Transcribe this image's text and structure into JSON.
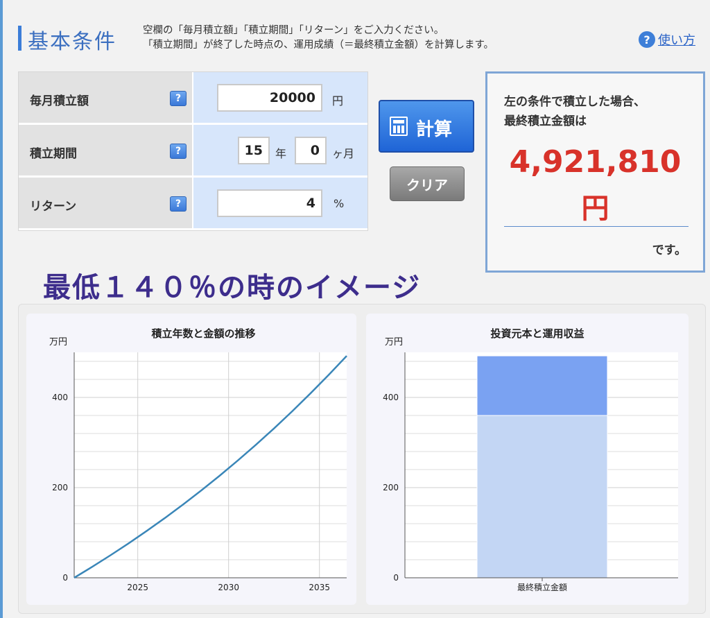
{
  "header": {
    "title": "基本条件",
    "desc_line1": "空欄の「毎月積立額」「積立期間」「リターン」をご入力ください。",
    "desc_line2": "「積立期間」が終了した時点の、運用成績（＝最終積立金額）を計算します。",
    "help_icon": "?",
    "help_label": "使い方"
  },
  "form": {
    "help_icon": "?",
    "monthly": {
      "label": "毎月積立額",
      "value": "20000",
      "unit": "円"
    },
    "period": {
      "label": "積立期間",
      "years": "15",
      "years_unit": "年",
      "months": "0",
      "months_unit": "ヶ月"
    },
    "return": {
      "label": "リターン",
      "value": "4",
      "unit": "%"
    }
  },
  "buttons": {
    "calc": "計算",
    "clear": "クリア"
  },
  "result": {
    "line1": "左の条件で積立した場合、",
    "line2": "最終積立金額は",
    "amount": "4,921,810",
    "unit": "円",
    "suffix": "です。"
  },
  "image_heading": "最低１４０％の時のイメージ",
  "colors": {
    "accent": "#3b7dd8",
    "result_red": "#d8322a",
    "line": "#3a86b8",
    "principal": "#c3d6f4",
    "profit": "#7aa2f2"
  },
  "chart_data": [
    {
      "type": "line",
      "title": "積立年数と金額の推移",
      "ylabel": "万円",
      "xlim": [
        2021.5,
        2036.5
      ],
      "ylim": [
        0,
        500
      ],
      "x_ticks": [
        2025,
        2030,
        2035
      ],
      "y_ticks": [
        0,
        200,
        400
      ],
      "grid": true,
      "series": [
        {
          "x": [
            2021.5,
            2022.5,
            2023.5,
            2024.5,
            2025.5,
            2026.5,
            2027.5,
            2028.5,
            2029.5,
            2030.5,
            2031.5,
            2032.5,
            2033.5,
            2034.5,
            2035.5,
            2036.5
          ],
          "values": [
            0,
            24.5,
            50,
            76.5,
            104.1,
            132.8,
            162.7,
            193.8,
            226.2,
            259.8,
            294.9,
            331.3,
            369.2,
            408.7,
            449.7,
            492.2
          ]
        }
      ]
    },
    {
      "type": "bar",
      "title": "投資元本と運用収益",
      "ylabel": "万円",
      "categories": [
        "最終積立金額"
      ],
      "ylim": [
        0,
        500
      ],
      "y_ticks": [
        0,
        200,
        400
      ],
      "grid": true,
      "stacked": true,
      "series": [
        {
          "values": [
            360
          ]
        },
        {
          "values": [
            132.2
          ]
        }
      ]
    }
  ]
}
